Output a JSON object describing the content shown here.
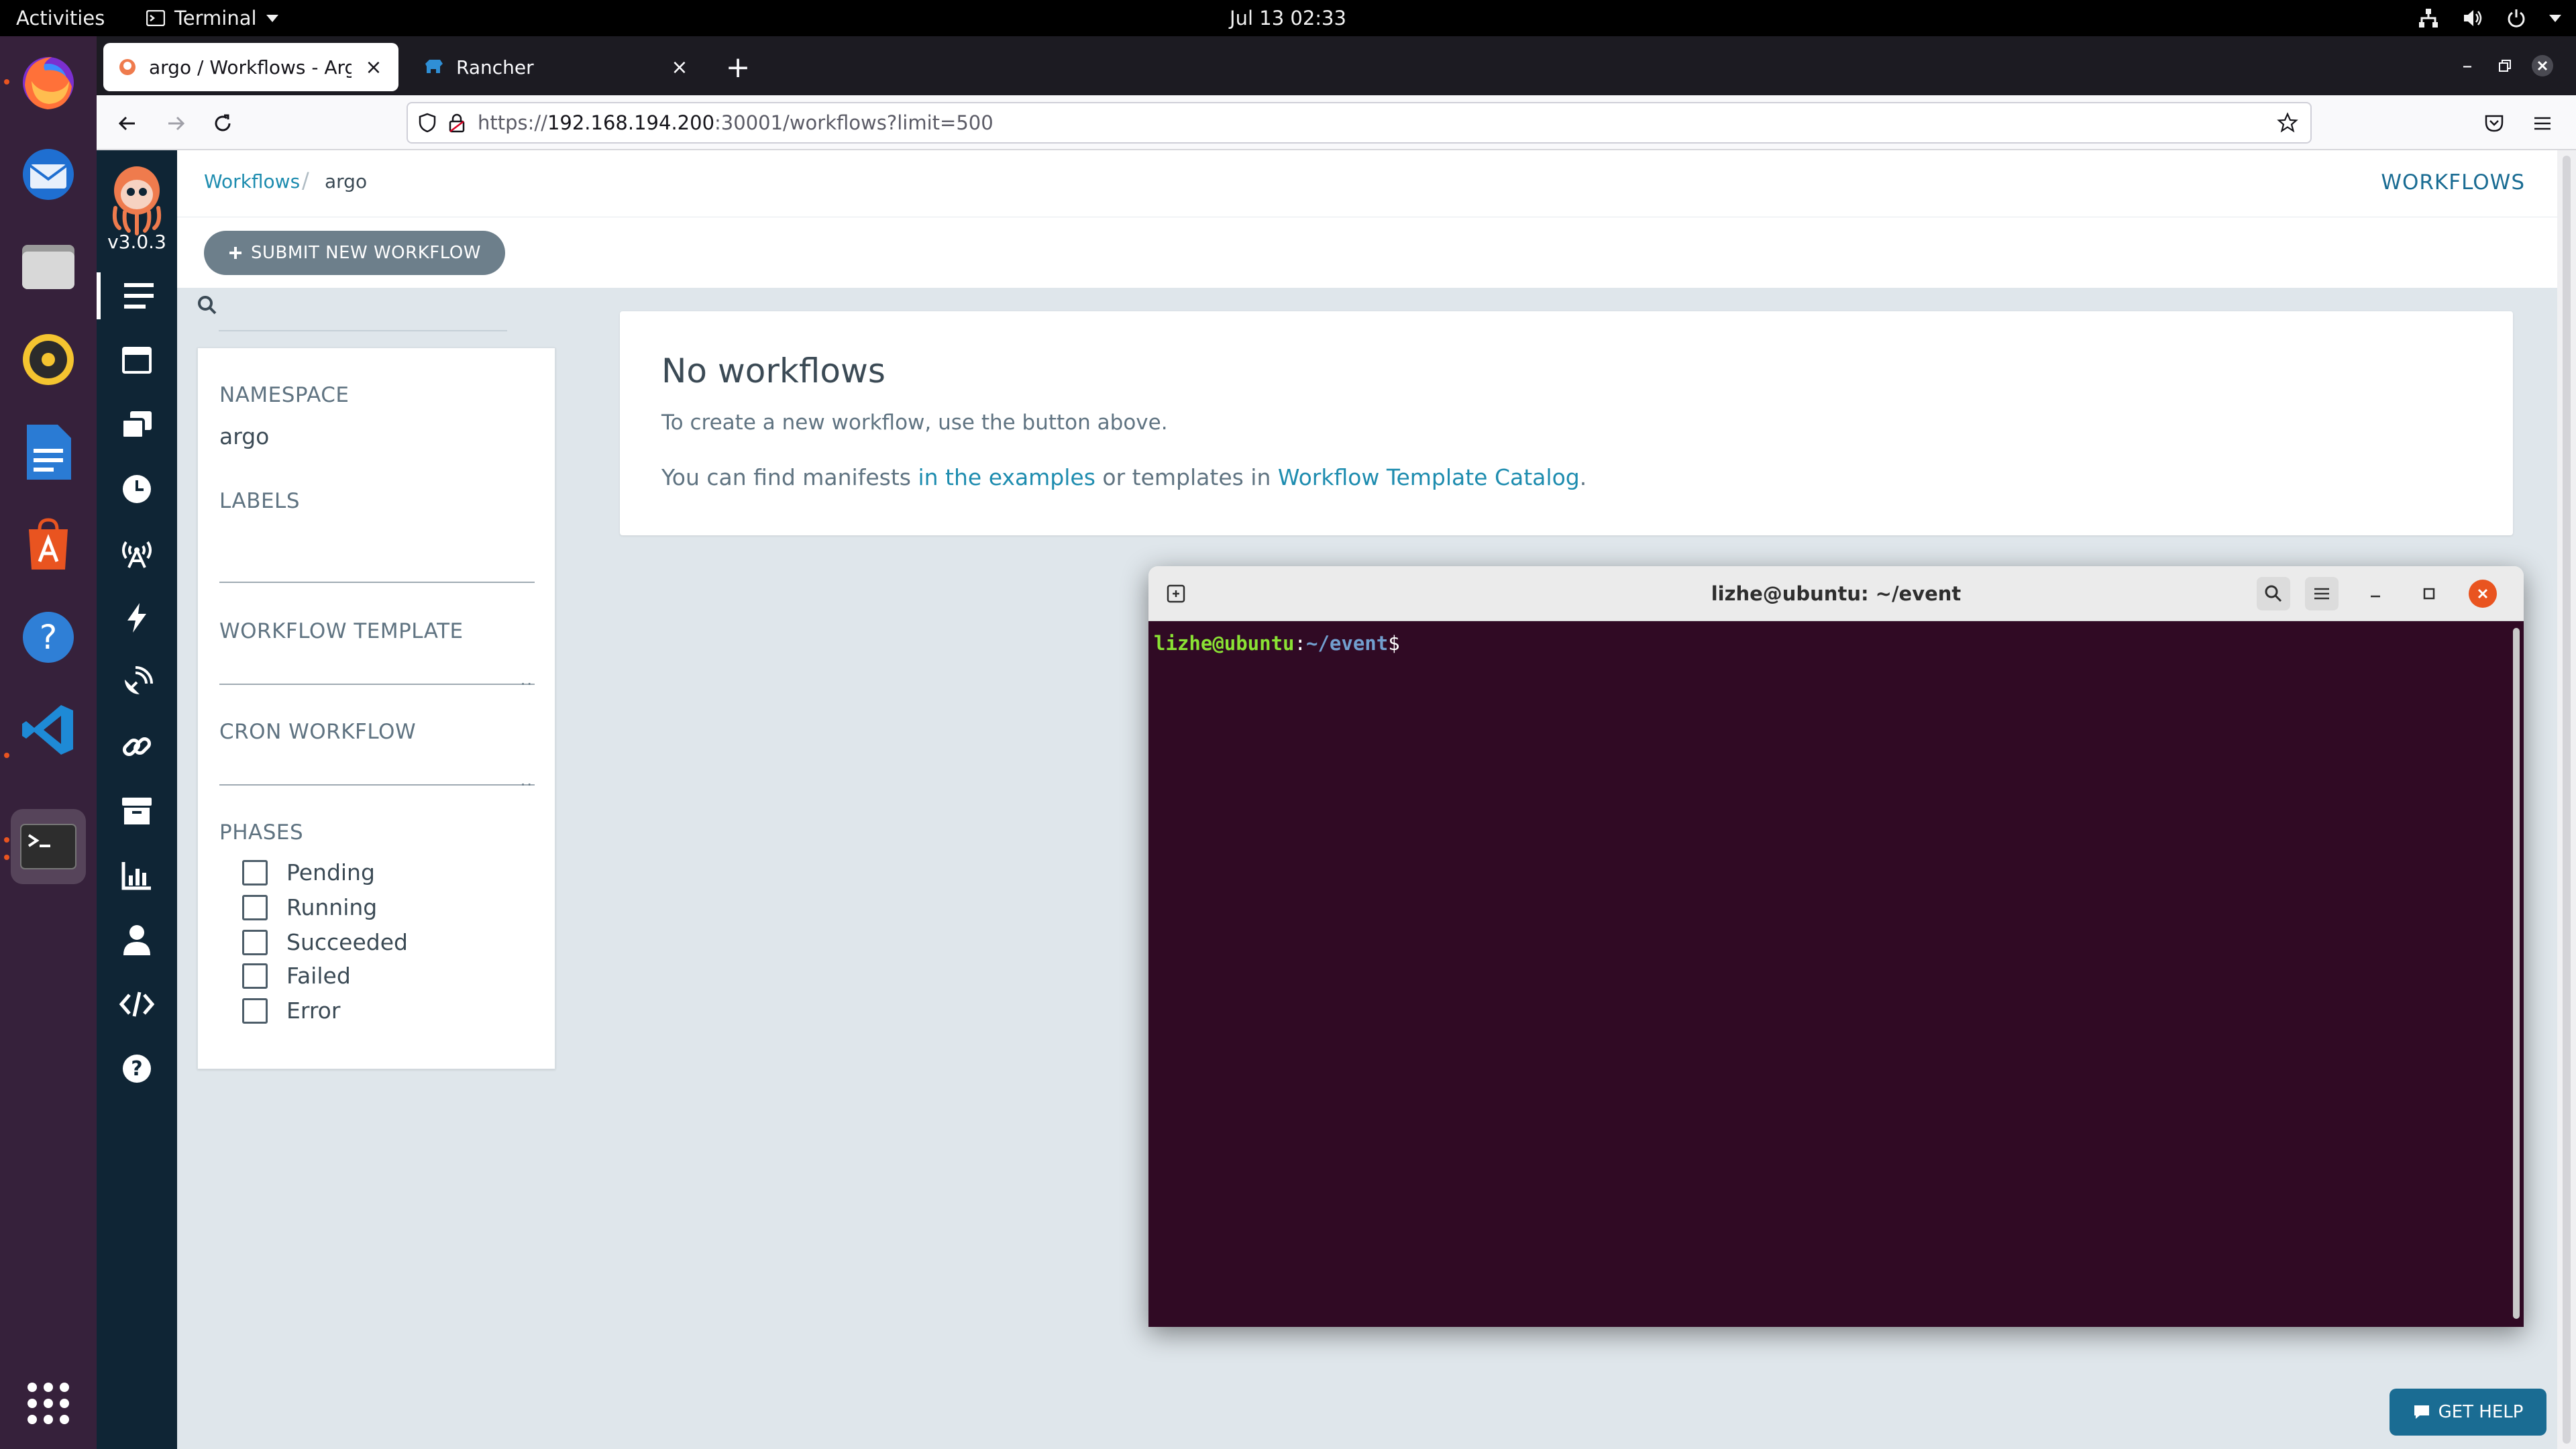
{
  "system": {
    "activities": "Activities",
    "app_menu": "Terminal",
    "clock": "Jul 13  02:33"
  },
  "browser": {
    "tabs": [
      {
        "title": "argo / Workflows - Argo"
      },
      {
        "title": "Rancher"
      }
    ],
    "url": {
      "prefix": "https://",
      "host": "192.168.194.200",
      "rest": ":30001/workflows?limit=500"
    }
  },
  "argo": {
    "version": "v3.0.3",
    "breadcrumb": {
      "root": "Workflows",
      "separator": "/",
      "current": "argo"
    },
    "header_title": "WORKFLOWS",
    "submit_label": "SUBMIT NEW WORKFLOW",
    "filters": {
      "namespace_label": "NAMESPACE",
      "namespace_value": "argo",
      "labels_label": "LABELS",
      "workflow_template_label": "WORKFLOW TEMPLATE",
      "cron_workflow_label": "CRON WORKFLOW",
      "phases_label": "PHASES",
      "phases": [
        "Pending",
        "Running",
        "Succeeded",
        "Failed",
        "Error"
      ]
    },
    "empty": {
      "title": "No workflows",
      "line1": "To create a new workflow, use the button above.",
      "line2_a": "You can find manifests ",
      "link_examples": "in the examples",
      "line2_b": " or templates in ",
      "link_catalog": "Workflow Template Catalog",
      "line2_c": "."
    },
    "get_help": "GET HELP"
  },
  "terminal": {
    "title": "lizhe@ubuntu: ~/event",
    "prompt_user": "lizhe@ubuntu",
    "prompt_sep": ":",
    "prompt_path": "~/event",
    "prompt_symbol": "$"
  },
  "colors": {
    "argo_nav": "#0f2535",
    "argo_link": "#1d8caf",
    "terminal_bg": "#300a24",
    "ubuntu_orange": "#e95420"
  }
}
